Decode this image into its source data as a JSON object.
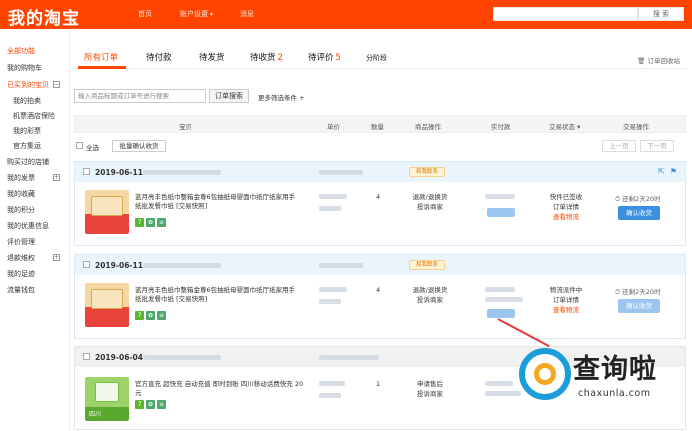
{
  "header": {
    "logo": "我的淘宝",
    "nav": [
      "首页",
      "账户设置",
      "消息"
    ],
    "search_button": "搜 索"
  },
  "sidebar": {
    "items": [
      {
        "label": "全部功能",
        "red": true
      },
      {
        "label": "我的购物车"
      },
      {
        "label": "已买到的宝贝",
        "red": true
      },
      {
        "label": "我的拍卖",
        "sub": true
      },
      {
        "label": "机票酒店保险",
        "sub": true
      },
      {
        "label": "我的彩票",
        "sub": true
      },
      {
        "label": "官方集运",
        "sub": true
      },
      {
        "label": "购买过的店铺"
      },
      {
        "label": "我的发票"
      },
      {
        "label": "我的收藏"
      },
      {
        "label": "我的积分"
      },
      {
        "label": "我的优惠信息"
      },
      {
        "label": "评价管理"
      },
      {
        "label": "退款维权"
      },
      {
        "label": "我的足迹"
      },
      {
        "label": "流量钱包"
      }
    ]
  },
  "tabs": [
    {
      "label": "所有订单",
      "active": true
    },
    {
      "label": "待付款"
    },
    {
      "label": "待发货"
    },
    {
      "label": "待收货",
      "count": "2"
    },
    {
      "label": "待评价",
      "count": "5"
    },
    {
      "label": "分阶段"
    }
  ],
  "recycle": "订单回收站",
  "search": {
    "placeholder": "输入商品标题或订单号进行搜索",
    "button": "订单搜索",
    "more": "更多筛选条件"
  },
  "table_headers": [
    "宝贝",
    "单价",
    "数量",
    "商品操作",
    "实付款",
    "交易状态",
    "交易操作"
  ],
  "bulk": {
    "select_all": "全选",
    "confirm_batch": "批量确认收货",
    "prev": "上一页",
    "next": "下一页"
  },
  "orders": [
    {
      "date": "2019-06-11",
      "badge": "和我联系",
      "title": "蓝月亮丰色纸巾整箱金尊6包抽纸母婴面巾纸厅纸家用手纸批发餐巾纸 [交易快照]",
      "qty": "4",
      "ops": [
        "退款/退换货",
        "投诉商家"
      ],
      "status": [
        "快件已签收",
        "订单详情",
        "查看物流"
      ],
      "countdown": "还剩2天20时",
      "confirm": "确认收货"
    },
    {
      "date": "2019-06-11",
      "badge": "和我联系",
      "title": "蓝月亮丰色纸巾整箱金尊6包抽纸母婴面巾纸厅纸家用手纸批发餐巾纸 [交易快照]",
      "qty": "4",
      "ops": [
        "退款/退换货",
        "投诉商家"
      ],
      "status": [
        "物流派件中",
        "订单详情",
        "查看物流"
      ],
      "countdown": "还剩2天20时",
      "confirm": "确认收货"
    },
    {
      "date": "2019-06-04",
      "title": "官方直充 超快充 自动充值 即时到账 四川移动话费快充 20元",
      "thumb_label": "四川",
      "qty": "1",
      "ops": [
        "申请售后",
        "投诉商家"
      ]
    }
  ],
  "watermark": {
    "text": "查询啦",
    "url": "chaxunla.com"
  }
}
